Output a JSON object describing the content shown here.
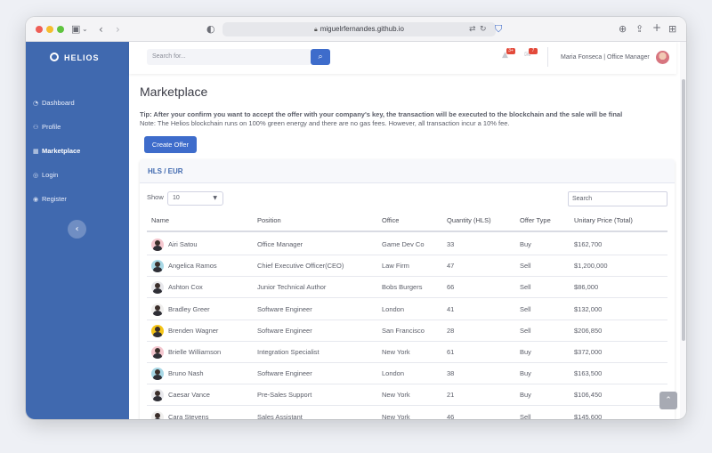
{
  "browser": {
    "url": "miguelrfernandes.github.io",
    "colors": {
      "close": "#ee5e56",
      "minimize": "#f5bd2f",
      "zoom": "#5fc43f"
    }
  },
  "sidebar": {
    "brand": "HELIOS",
    "items": [
      {
        "label": "Dashboard",
        "icon": "dashboard-icon"
      },
      {
        "label": "Profile",
        "icon": "user-icon"
      },
      {
        "label": "Marketplace",
        "icon": "table-icon",
        "active": true
      },
      {
        "label": "Login",
        "icon": "login-icon"
      },
      {
        "label": "Register",
        "icon": "register-icon"
      }
    ],
    "collapse_icon": "chevron-left-icon",
    "color": "#4069af"
  },
  "topbar": {
    "search_placeholder": "Search for...",
    "alerts_badge": "3+",
    "messages_badge": "7",
    "user": "Maria Fonseca | Office Manager"
  },
  "page": {
    "title": "Marketplace",
    "tip": "Tip: After your confirm you want to accept the offer with your company's key, the transaction will be executed to the blockchain and the sale will be final",
    "note": "Note: The Helios blockchain runs on 100% green energy and there are no gas fees. However, all transaction incur a 10% fee.",
    "create_button": "Create Offer"
  },
  "table_card": {
    "title": "HLS / EUR",
    "show_label": "Show",
    "page_size": "10",
    "search_placeholder": "Search",
    "columns": [
      "Name",
      "Position",
      "Office",
      "Quantity (HLS)",
      "Offer Type",
      "Unitary Price (Total)"
    ],
    "rows": [
      {
        "name": "Airi Satou",
        "position": "Office Manager",
        "office": "Game Dev Co",
        "qty": "33",
        "type": "Buy",
        "price": "$162,700",
        "avatar_bg": "#f4c7cf"
      },
      {
        "name": "Angelica Ramos",
        "position": "Chief Executive Officer(CEO)",
        "office": "Law Firm",
        "qty": "47",
        "type": "Sell",
        "price": "$1,200,000",
        "avatar_bg": "#a8d8e6"
      },
      {
        "name": "Ashton Cox",
        "position": "Junior Technical Author",
        "office": "Bobs Burgers",
        "qty": "66",
        "type": "Sell",
        "price": "$86,000",
        "avatar_bg": "#e8e8ec"
      },
      {
        "name": "Bradley Greer",
        "position": "Software Engineer",
        "office": "London",
        "qty": "41",
        "type": "Sell",
        "price": "$132,000",
        "avatar_bg": "#f0efee"
      },
      {
        "name": "Brenden Wagner",
        "position": "Software Engineer",
        "office": "San Francisco",
        "qty": "28",
        "type": "Sell",
        "price": "$206,850",
        "avatar_bg": "#f5c518"
      },
      {
        "name": "Brielle Williamson",
        "position": "Integration Specialist",
        "office": "New York",
        "qty": "61",
        "type": "Buy",
        "price": "$372,000",
        "avatar_bg": "#f4c7cf"
      },
      {
        "name": "Bruno Nash",
        "position": "Software Engineer",
        "office": "London",
        "qty": "38",
        "type": "Buy",
        "price": "$163,500",
        "avatar_bg": "#a8d8e6"
      },
      {
        "name": "Caesar Vance",
        "position": "Pre-Sales Support",
        "office": "New York",
        "qty": "21",
        "type": "Buy",
        "price": "$106,450",
        "avatar_bg": "#e8e8ec"
      },
      {
        "name": "Cara Stevens",
        "position": "Sales Assistant",
        "office": "New York",
        "qty": "46",
        "type": "Sell",
        "price": "$145,600",
        "avatar_bg": "#f0efee"
      }
    ]
  }
}
